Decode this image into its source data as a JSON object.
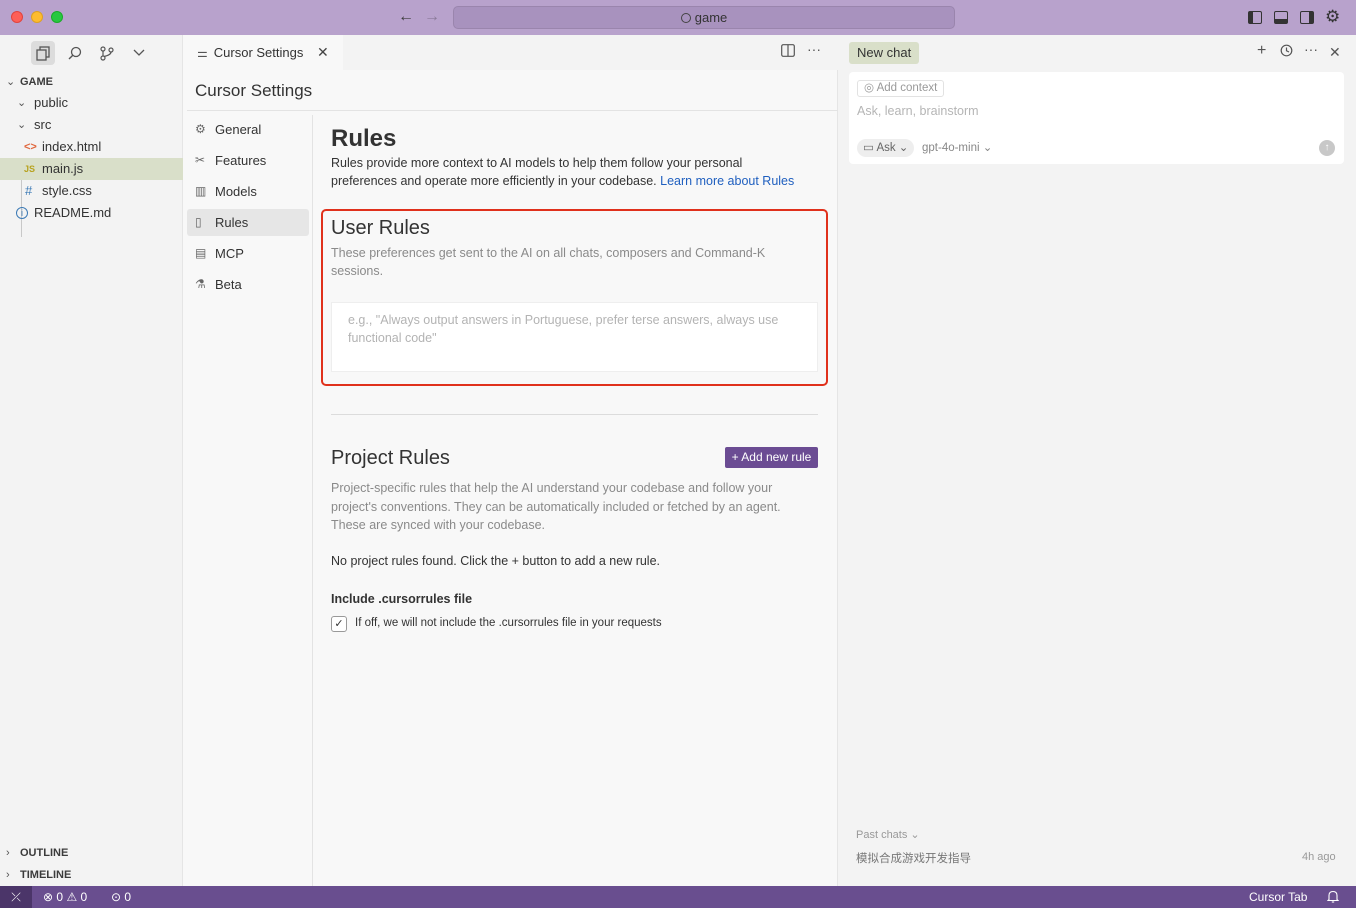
{
  "titlebar": {
    "search_text": "game",
    "back": "←",
    "forward": "→"
  },
  "sidebar": {
    "explorer_title": "GAME",
    "tree": [
      {
        "label": "public",
        "icon": "chevron-down"
      },
      {
        "label": "src",
        "icon": "chevron-down"
      },
      {
        "label": "index.html",
        "icon": "html-file"
      },
      {
        "label": "main.js",
        "icon": "js-file"
      },
      {
        "label": "style.css",
        "icon": "css-file"
      },
      {
        "label": "README.md",
        "icon": "info-file"
      }
    ],
    "outline_label": "OUTLINE",
    "timeline_label": "TIMELINE"
  },
  "editor": {
    "tab_label": "Cursor Settings",
    "settings_title": "Cursor Settings",
    "nav": [
      {
        "label": "General",
        "icon": "gear"
      },
      {
        "label": "Features",
        "icon": "tools"
      },
      {
        "label": "Models",
        "icon": "chart"
      },
      {
        "label": "Rules",
        "icon": "document"
      },
      {
        "label": "MCP",
        "icon": "server"
      },
      {
        "label": "Beta",
        "icon": "flask"
      }
    ],
    "rules": {
      "heading": "Rules",
      "description": "Rules provide more context to AI models to help them follow your personal preferences and operate more efficiently in your codebase.",
      "learn_more": "Learn more about Rules",
      "user_rules_title": "User Rules",
      "user_rules_desc": "These preferences get sent to the AI on all chats, composers and Command-K sessions.",
      "user_rules_placeholder": "e.g., \"Always output answers in Portuguese, prefer terse answers, always use functional code\"",
      "project_rules_title": "Project Rules",
      "add_rule_label": "+ Add new rule",
      "project_rules_desc": "Project-specific rules that help the AI understand your codebase and follow your project's conventions. They can be automatically included or fetched by an agent. These are synced with your codebase.",
      "no_rules": "No project rules found. Click the + button to add a new rule.",
      "include_label": "Include .cursorrules file",
      "include_desc": "If off, we will not include the .cursorrules file in your requests",
      "include_checked": true
    }
  },
  "chat": {
    "tab_label": "New chat",
    "add_context": "Add context",
    "placeholder": "Ask, learn, brainstorm",
    "mode": "Ask",
    "model": "gpt-4o-mini",
    "past_chats_label": "Past chats",
    "past_items": [
      {
        "title": "模拟合成游戏开发指导",
        "time": "4h ago"
      }
    ]
  },
  "statusbar": {
    "errors": "0",
    "warnings": "0",
    "ports": "0",
    "cursor_tab": "Cursor Tab"
  },
  "colors": {
    "titlebar": "#b8a2cc",
    "statusbar": "#694e8f",
    "accent_button": "#6b4c93",
    "selection": "#d9dfc9",
    "highlight_box": "#e0311c",
    "link": "#1f5fbf"
  }
}
